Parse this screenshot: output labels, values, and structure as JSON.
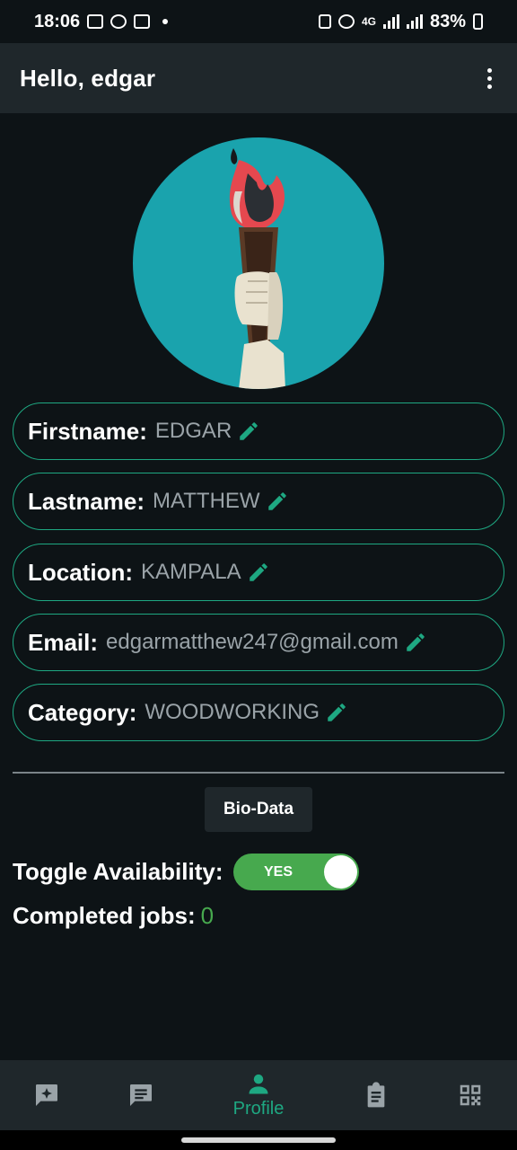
{
  "status_bar": {
    "time": "18:06",
    "network": "4G",
    "battery": "83%"
  },
  "app_bar": {
    "title": "Hello, edgar",
    "menu_icon": "more-vert-icon"
  },
  "profile": {
    "fields": [
      {
        "label": "Firstname:",
        "value": "EDGAR"
      },
      {
        "label": "Lastname:",
        "value": "MATTHEW"
      },
      {
        "label": "Location:",
        "value": "KAMPALA"
      },
      {
        "label": "Email:",
        "value": "edgarmatthew247@gmail.com"
      },
      {
        "label": "Category:",
        "value": "WOODWORKING"
      }
    ],
    "bio_button": "Bio-Data",
    "availability_label": "Toggle Availability:",
    "availability_value": "YES",
    "completed_label": "Completed jobs:",
    "completed_count": "0"
  },
  "bottom_nav": {
    "items": [
      {
        "icon": "sparkle-chat-icon"
      },
      {
        "icon": "chat-icon"
      },
      {
        "icon": "person-icon",
        "label": "Profile",
        "active": true
      },
      {
        "icon": "clipboard-icon"
      },
      {
        "icon": "qr-code-icon"
      }
    ]
  },
  "colors": {
    "accent": "#1ea882",
    "toggle_on": "#47a94e",
    "surface": "#1f272b",
    "background": "#0d1316",
    "avatar_bg": "#1aa3ad"
  }
}
